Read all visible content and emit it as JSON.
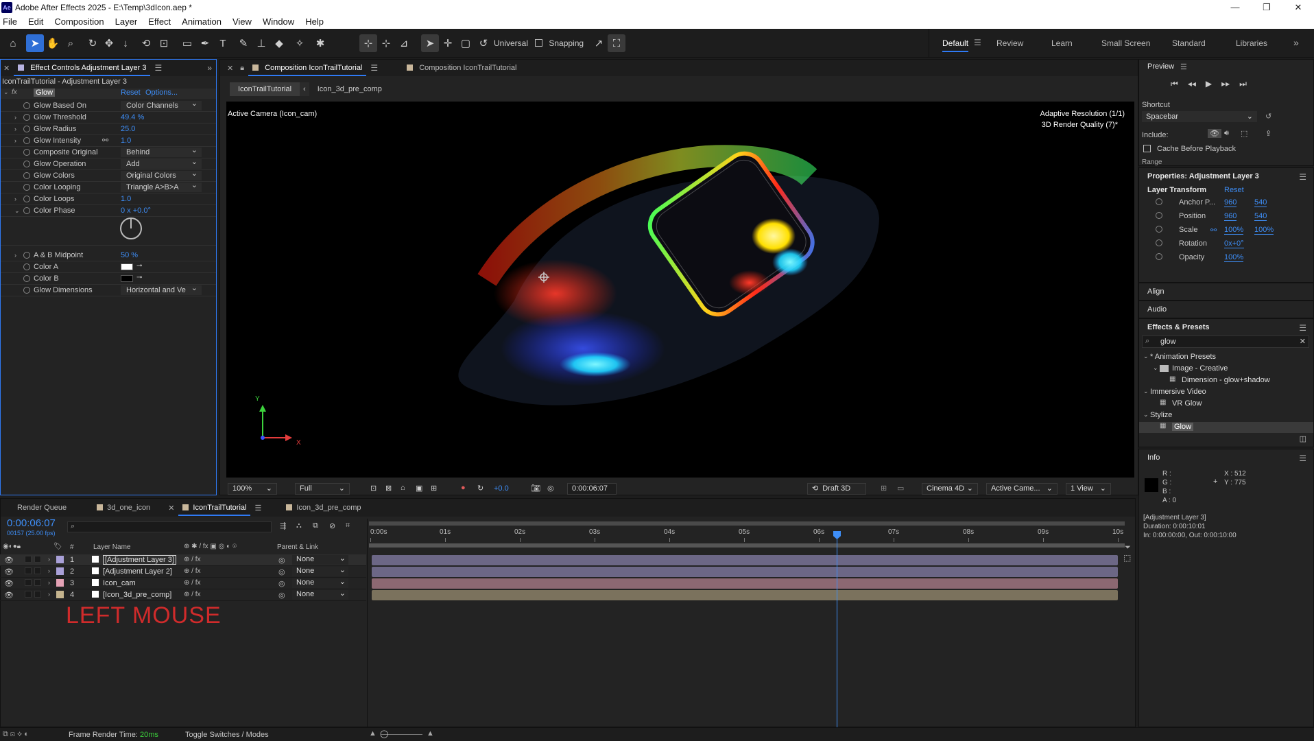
{
  "window": {
    "title": "Adobe After Effects 2025 - E:\\Temp\\3dIcon.aep *",
    "app_badge": "Ae"
  },
  "menu": [
    "File",
    "Edit",
    "Composition",
    "Layer",
    "Effect",
    "Animation",
    "View",
    "Window",
    "Help"
  ],
  "toolbar": {
    "universal_label": "Universal",
    "snapping_label": "Snapping",
    "workspaces": [
      "Default",
      "Review",
      "Learn",
      "Small Screen",
      "Standard",
      "Libraries"
    ],
    "active_workspace": "Default"
  },
  "effect_controls": {
    "tab_label": "Effect Controls Adjustment Layer 3",
    "layer_path": "IconTrailTutorial - Adjustment Layer 3",
    "effect_name": "Glow",
    "reset_label": "Reset",
    "options_label": "Options...",
    "properties": [
      {
        "name": "Glow Based On",
        "value": "Color Channels",
        "kind": "dropdown",
        "twirl": ""
      },
      {
        "name": "Glow Threshold",
        "value": "49.4 %",
        "kind": "value",
        "twirl": "›"
      },
      {
        "name": "Glow Radius",
        "value": "25.0",
        "kind": "value",
        "twirl": "›"
      },
      {
        "name": "Glow Intensity",
        "value": "1.0",
        "kind": "value",
        "twirl": "›"
      },
      {
        "name": "Composite Original",
        "value": "Behind",
        "kind": "dropdown",
        "twirl": ""
      },
      {
        "name": "Glow Operation",
        "value": "Add",
        "kind": "dropdown",
        "twirl": ""
      },
      {
        "name": "Glow Colors",
        "value": "Original Colors",
        "kind": "dropdown",
        "twirl": ""
      },
      {
        "name": "Color Looping",
        "value": "Triangle A>B>A",
        "kind": "dropdown",
        "twirl": ""
      },
      {
        "name": "Color Loops",
        "value": "1.0",
        "kind": "value",
        "twirl": "›"
      },
      {
        "name": "Color Phase",
        "value": "0 x +0.0°",
        "kind": "value",
        "twirl": "⌄"
      }
    ],
    "properties2": [
      {
        "name": "A & B Midpoint",
        "value": "50 %",
        "kind": "value",
        "twirl": "›"
      },
      {
        "name": "Color A",
        "value": "",
        "kind": "color-white",
        "twirl": ""
      },
      {
        "name": "Color B",
        "value": "",
        "kind": "color-black",
        "twirl": ""
      },
      {
        "name": "Glow Dimensions",
        "value": "Horizontal and Ve",
        "kind": "dropdown",
        "twirl": ""
      }
    ]
  },
  "composition": {
    "tab1": "Composition IconTrailTutorial",
    "tab2": "Composition IconTrailTutorial",
    "breadcrumb_active": "IconTrailTutorial",
    "breadcrumb_next": "Icon_3d_pre_comp",
    "camera_label": "Active Camera (Icon_cam)",
    "adaptive_res": "Adaptive Resolution (1/1)",
    "render_quality": "3D Render Quality (7)*",
    "axis_y": "Y",
    "axis_x": "X",
    "zoom": "100%",
    "resolution": "Full",
    "exposure": "+0.0",
    "timecode": "0:00:06:07",
    "renderer_mode": "Draft 3D",
    "renderer": "Cinema 4D",
    "camera_view": "Active Came...",
    "views": "1 View"
  },
  "preview": {
    "title": "Preview",
    "shortcut_label": "Shortcut",
    "shortcut_value": "Spacebar",
    "include_label": "Include:",
    "cache_label": "Cache Before Playback",
    "range_label": "Range"
  },
  "properties": {
    "title": "Properties: Adjustment Layer 3",
    "group": "Layer Transform",
    "reset": "Reset",
    "rows": [
      {
        "name": "Anchor P...",
        "v1": "960",
        "v2": "540"
      },
      {
        "name": "Position",
        "v1": "960",
        "v2": "540"
      },
      {
        "name": "Scale",
        "v1": "100%",
        "v2": "100%"
      },
      {
        "name": "Rotation",
        "v1": "0x+0°",
        "v2": ""
      },
      {
        "name": "Opacity",
        "v1": "100%",
        "v2": ""
      }
    ]
  },
  "align_label": "Align",
  "audio_label": "Audio",
  "effects_presets": {
    "title": "Effects & Presets",
    "search": "glow",
    "tree": [
      {
        "label": "* Animation Presets",
        "indent": 0,
        "twirl": "⌄",
        "icon": false,
        "selected": false
      },
      {
        "label": "Image - Creative",
        "indent": 1,
        "twirl": "⌄",
        "icon": "folder",
        "selected": false
      },
      {
        "label": "Dimension - glow+shadow",
        "indent": 2,
        "twirl": "",
        "icon": "fx",
        "selected": false
      },
      {
        "label": "Immersive Video",
        "indent": 0,
        "twirl": "⌄",
        "icon": false,
        "selected": false
      },
      {
        "label": "VR Glow",
        "indent": 1,
        "twirl": "",
        "icon": "fx",
        "selected": false
      },
      {
        "label": "Stylize",
        "indent": 0,
        "twirl": "⌄",
        "icon": false,
        "selected": false
      },
      {
        "label": "Glow",
        "indent": 1,
        "twirl": "",
        "icon": "fx",
        "selected": true
      }
    ]
  },
  "info": {
    "title": "Info",
    "r": "R :",
    "g": "G :",
    "b": "B :",
    "a": "A :  0",
    "x": "X : 512",
    "y": "Y : 775",
    "layer": "[Adjustment Layer 3]",
    "duration": "Duration: 0:00:10:01",
    "inout": "In: 0:00:00:00, Out: 0:00:10:00"
  },
  "timeline": {
    "tabs": [
      "Render Queue",
      "3d_one_icon",
      "IconTrailTutorial",
      "Icon_3d_pre_comp"
    ],
    "active_tab": "IconTrailTutorial",
    "timecode": "0:00:06:07",
    "frames": "00157 (25.00 fps)",
    "col_hash": "#",
    "col_layer_name": "Layer Name",
    "col_parent": "Parent & Link",
    "layers": [
      {
        "num": "1",
        "name": "[Adjustment Layer 3]",
        "parent": "None",
        "color": "#a9a0d8",
        "boxed": true
      },
      {
        "num": "2",
        "name": "[Adjustment Layer 2]",
        "parent": "None",
        "color": "#a9a0d8",
        "boxed": false
      },
      {
        "num": "3",
        "name": "Icon_cam",
        "parent": "None",
        "color": "#e4a2b5",
        "boxed": false
      },
      {
        "num": "4",
        "name": "[Icon_3d_pre_comp]",
        "parent": "None",
        "color": "#c5b48e",
        "boxed": false
      }
    ],
    "ruler": [
      "0:00s",
      "01s",
      "02s",
      "03s",
      "04s",
      "05s",
      "06s",
      "07s",
      "08s",
      "09s",
      "10s"
    ],
    "overlay_text": "LEFT MOUSE"
  },
  "status": {
    "frame_render_label": "Frame Render Time:",
    "frame_render_value": "20ms",
    "toggle_label": "Toggle Switches / Modes"
  },
  "colors": {
    "accent": "#2f7af5",
    "value_blue": "#3e8ef7",
    "overlay_red": "#d02b2b"
  }
}
